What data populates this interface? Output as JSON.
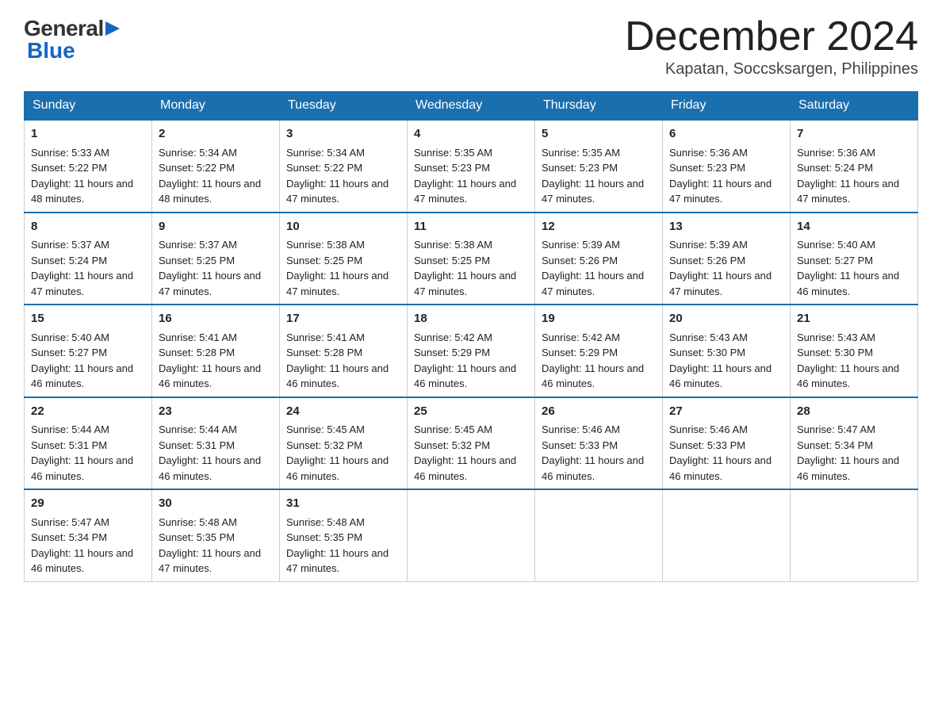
{
  "header": {
    "logo_general": "General",
    "logo_blue": "Blue",
    "month_title": "December 2024",
    "location": "Kapatan, Soccsksargen, Philippines"
  },
  "weekdays": [
    "Sunday",
    "Monday",
    "Tuesday",
    "Wednesday",
    "Thursday",
    "Friday",
    "Saturday"
  ],
  "weeks": [
    [
      {
        "day": "1",
        "sunrise": "5:33 AM",
        "sunset": "5:22 PM",
        "daylight": "11 hours and 48 minutes."
      },
      {
        "day": "2",
        "sunrise": "5:34 AM",
        "sunset": "5:22 PM",
        "daylight": "11 hours and 48 minutes."
      },
      {
        "day": "3",
        "sunrise": "5:34 AM",
        "sunset": "5:22 PM",
        "daylight": "11 hours and 47 minutes."
      },
      {
        "day": "4",
        "sunrise": "5:35 AM",
        "sunset": "5:23 PM",
        "daylight": "11 hours and 47 minutes."
      },
      {
        "day": "5",
        "sunrise": "5:35 AM",
        "sunset": "5:23 PM",
        "daylight": "11 hours and 47 minutes."
      },
      {
        "day": "6",
        "sunrise": "5:36 AM",
        "sunset": "5:23 PM",
        "daylight": "11 hours and 47 minutes."
      },
      {
        "day": "7",
        "sunrise": "5:36 AM",
        "sunset": "5:24 PM",
        "daylight": "11 hours and 47 minutes."
      }
    ],
    [
      {
        "day": "8",
        "sunrise": "5:37 AM",
        "sunset": "5:24 PM",
        "daylight": "11 hours and 47 minutes."
      },
      {
        "day": "9",
        "sunrise": "5:37 AM",
        "sunset": "5:25 PM",
        "daylight": "11 hours and 47 minutes."
      },
      {
        "day": "10",
        "sunrise": "5:38 AM",
        "sunset": "5:25 PM",
        "daylight": "11 hours and 47 minutes."
      },
      {
        "day": "11",
        "sunrise": "5:38 AM",
        "sunset": "5:25 PM",
        "daylight": "11 hours and 47 minutes."
      },
      {
        "day": "12",
        "sunrise": "5:39 AM",
        "sunset": "5:26 PM",
        "daylight": "11 hours and 47 minutes."
      },
      {
        "day": "13",
        "sunrise": "5:39 AM",
        "sunset": "5:26 PM",
        "daylight": "11 hours and 47 minutes."
      },
      {
        "day": "14",
        "sunrise": "5:40 AM",
        "sunset": "5:27 PM",
        "daylight": "11 hours and 46 minutes."
      }
    ],
    [
      {
        "day": "15",
        "sunrise": "5:40 AM",
        "sunset": "5:27 PM",
        "daylight": "11 hours and 46 minutes."
      },
      {
        "day": "16",
        "sunrise": "5:41 AM",
        "sunset": "5:28 PM",
        "daylight": "11 hours and 46 minutes."
      },
      {
        "day": "17",
        "sunrise": "5:41 AM",
        "sunset": "5:28 PM",
        "daylight": "11 hours and 46 minutes."
      },
      {
        "day": "18",
        "sunrise": "5:42 AM",
        "sunset": "5:29 PM",
        "daylight": "11 hours and 46 minutes."
      },
      {
        "day": "19",
        "sunrise": "5:42 AM",
        "sunset": "5:29 PM",
        "daylight": "11 hours and 46 minutes."
      },
      {
        "day": "20",
        "sunrise": "5:43 AM",
        "sunset": "5:30 PM",
        "daylight": "11 hours and 46 minutes."
      },
      {
        "day": "21",
        "sunrise": "5:43 AM",
        "sunset": "5:30 PM",
        "daylight": "11 hours and 46 minutes."
      }
    ],
    [
      {
        "day": "22",
        "sunrise": "5:44 AM",
        "sunset": "5:31 PM",
        "daylight": "11 hours and 46 minutes."
      },
      {
        "day": "23",
        "sunrise": "5:44 AM",
        "sunset": "5:31 PM",
        "daylight": "11 hours and 46 minutes."
      },
      {
        "day": "24",
        "sunrise": "5:45 AM",
        "sunset": "5:32 PM",
        "daylight": "11 hours and 46 minutes."
      },
      {
        "day": "25",
        "sunrise": "5:45 AM",
        "sunset": "5:32 PM",
        "daylight": "11 hours and 46 minutes."
      },
      {
        "day": "26",
        "sunrise": "5:46 AM",
        "sunset": "5:33 PM",
        "daylight": "11 hours and 46 minutes."
      },
      {
        "day": "27",
        "sunrise": "5:46 AM",
        "sunset": "5:33 PM",
        "daylight": "11 hours and 46 minutes."
      },
      {
        "day": "28",
        "sunrise": "5:47 AM",
        "sunset": "5:34 PM",
        "daylight": "11 hours and 46 minutes."
      }
    ],
    [
      {
        "day": "29",
        "sunrise": "5:47 AM",
        "sunset": "5:34 PM",
        "daylight": "11 hours and 46 minutes."
      },
      {
        "day": "30",
        "sunrise": "5:48 AM",
        "sunset": "5:35 PM",
        "daylight": "11 hours and 47 minutes."
      },
      {
        "day": "31",
        "sunrise": "5:48 AM",
        "sunset": "5:35 PM",
        "daylight": "11 hours and 47 minutes."
      },
      null,
      null,
      null,
      null
    ]
  ]
}
